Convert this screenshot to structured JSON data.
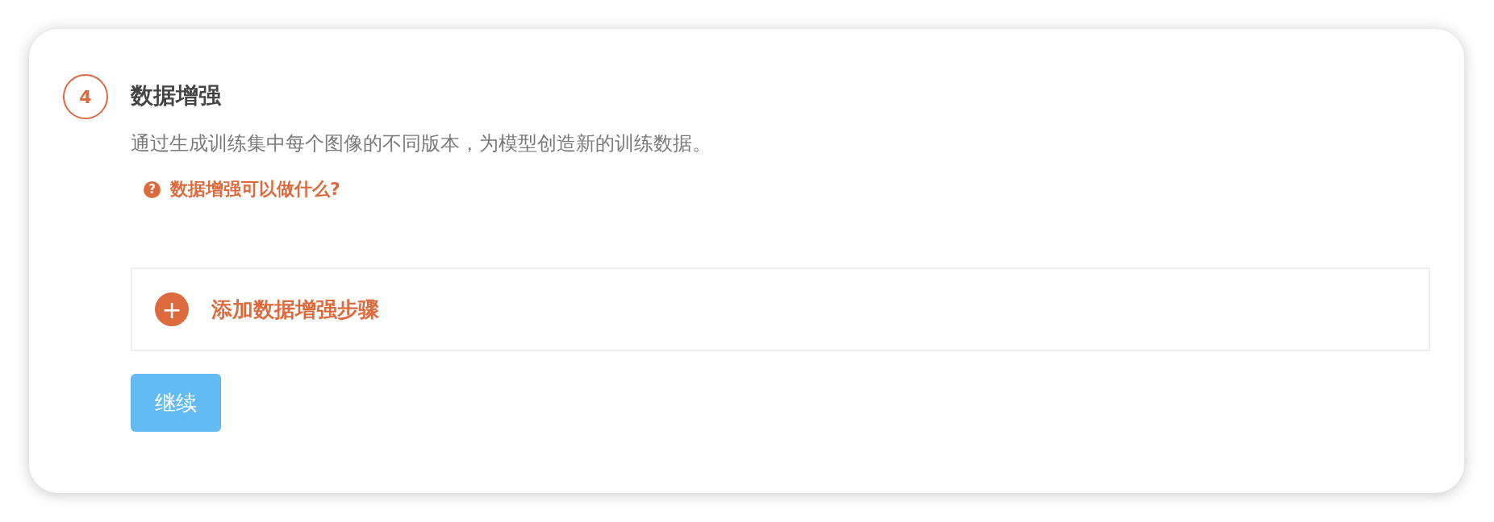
{
  "step": {
    "number": "4",
    "title": "数据增强",
    "description": "通过生成训练集中每个图像的不同版本，为模型创造新的训练数据。"
  },
  "help_link": {
    "icon": "?",
    "label": "数据增强可以做什么?"
  },
  "add_step": {
    "icon": "+",
    "label": "添加数据增强步骤"
  },
  "continue_button": {
    "label": "继续",
    "disabled": true
  }
}
